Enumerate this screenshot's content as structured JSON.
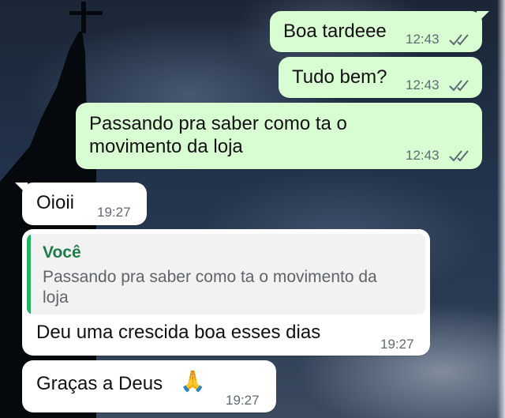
{
  "colors": {
    "outgoing_bubble": "#d9fdd3",
    "incoming_bubble": "#ffffff",
    "quote_bar": "#25b063",
    "quote_author": "#1f7a4a",
    "timestamp": "#5f6a70"
  },
  "messages": [
    {
      "direction": "outgoing",
      "text": "Boa tardeee",
      "time": "12:43",
      "status_icon": "double-check-icon"
    },
    {
      "direction": "outgoing",
      "text": "Tudo bem?",
      "time": "12:43",
      "status_icon": "double-check-icon"
    },
    {
      "direction": "outgoing",
      "lines": [
        "Passando pra saber como ta o",
        "movimento da loja"
      ],
      "time": "12:43",
      "status_icon": "double-check-icon"
    },
    {
      "direction": "incoming",
      "text": "Oioii",
      "time": "19:27"
    },
    {
      "direction": "incoming",
      "reply_to": {
        "author": "Você",
        "lines": [
          "Passando pra saber como ta o movimento da",
          "loja"
        ]
      },
      "text": "Deu uma crescida boa esses dias",
      "time": "19:27"
    },
    {
      "direction": "incoming",
      "text": "Graças a Deus",
      "emoji": "🙏",
      "time": "19:27"
    }
  ]
}
